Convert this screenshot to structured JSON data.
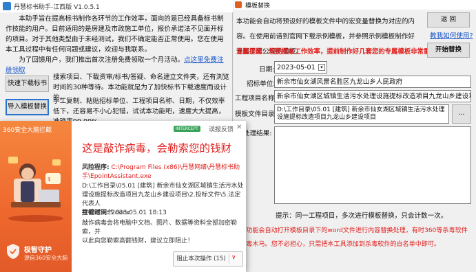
{
  "left_window": {
    "title": "丹慧标书助手-江西版 V1.0.5.1",
    "intro_p1": "本助手旨在提高标书制作各环节的工作效率，面向的是已经具备标书制作技能的用户。目前适用的是房建及市政施工单位，报价承诺法不见面开标的项目。对于其他类型由于未经测试，我们不确定能否正常使用。您在使用本工具过程中有任何问题或建议，欢迎与我联系。",
    "intro_p2": "为了回馈用户，我们推出首次注册免费领取一个月活动。",
    "register_link": "点这里免费注册领取",
    "download_btn": "快速下载标书",
    "download_desc": "搜索项目、下载资审/标书/答疑、命名建立文件夹，还有浏览时间的30种等待。本功能就是为了加快标书下载速度而设计的。",
    "import_btn": "导入模板替换",
    "import_desc": "手工复制、粘贴招标单位、工程项目名称、日期，不仅效率低下，还容易不小心犯错，试试本功能吧，速度大大提高，准确率99.99%"
  },
  "right_window": {
    "title": "模板替换",
    "desc": "本功能会自动将预设好的模板文件中的宏变量替换为对应的内容。在使用前请到官网下载示例模板，并参照示例模板制作好专属于您公司的模板。",
    "back_btn": "返 回",
    "howto_link": "教我如何使用?",
    "warning": "温馨提醒：想要提高工作效率，提前制作好几套您的专属模板非常重要哟!",
    "start_btn": "开始替换",
    "date_label": "日期:",
    "date_value": "2023-05-01",
    "bidder_label": "招标单位:",
    "bidder_value": "新余市仙女湖风景名胜区九龙山乡人民政府",
    "project_label": "工程项目名称:",
    "project_value": "新余市仙女湖区城镇生活污水处理设施提标改造项目九龙山乡建设项目",
    "template_label": "模板文件目录:",
    "template_value": "D:\\工作目录\\05.01 [建筑] 新余市仙女湖区城镇生活污水处理设施提标改造项目九龙山乡建设项目",
    "browse_btn": "...",
    "result_label": "处理结果:",
    "tip": "提示：同一工程项目，多次进行模板替换，只会计数一次。",
    "bottom_warning_1": "下本功能会自动打开模板目录下的word文件进行内容替换处理，有时360等杀毒软件",
    "bottom_warning_2": "误病毒木马。您不必担心，只需把本工具添加到杀毒软件的白名单中即可。"
  },
  "popup": {
    "brand": "360安全大脑拦截",
    "badge": "INTERCEPT",
    "feedback": "误报反馈",
    "close": "✕",
    "title": "这是敲诈病毒，会勒索您的钱财",
    "risk_label": "风险程序:",
    "risk_path": "C:\\Program Files (x86)\\丹慧网络\\丹慧标书助手\\EpointAssistant.exe",
    "file_line_1": "D:\\工作目录\\05.01 [建筑] 新余市仙女湖区城镇生活污水处",
    "file_line_2": "理设施提标改造项目九龙山乡建设项目\\2.投标文件\\5.法定代表人",
    "file_line_3": "身份证明书.docx",
    "time_label": "拦截时间:",
    "time_value": "2023.05.01 18:13",
    "desc_1": "敲诈病毒会将电脑中文档、图片、数据等资料全部加密勒索，并",
    "desc_2": "以此向您勒索高额钱财，建议立即阻止！",
    "protect_title": "极智守护",
    "protect_sub": "源自360安全大脑",
    "block_btn": "阻止本次操作 (15)",
    "dropdown": "∨"
  }
}
